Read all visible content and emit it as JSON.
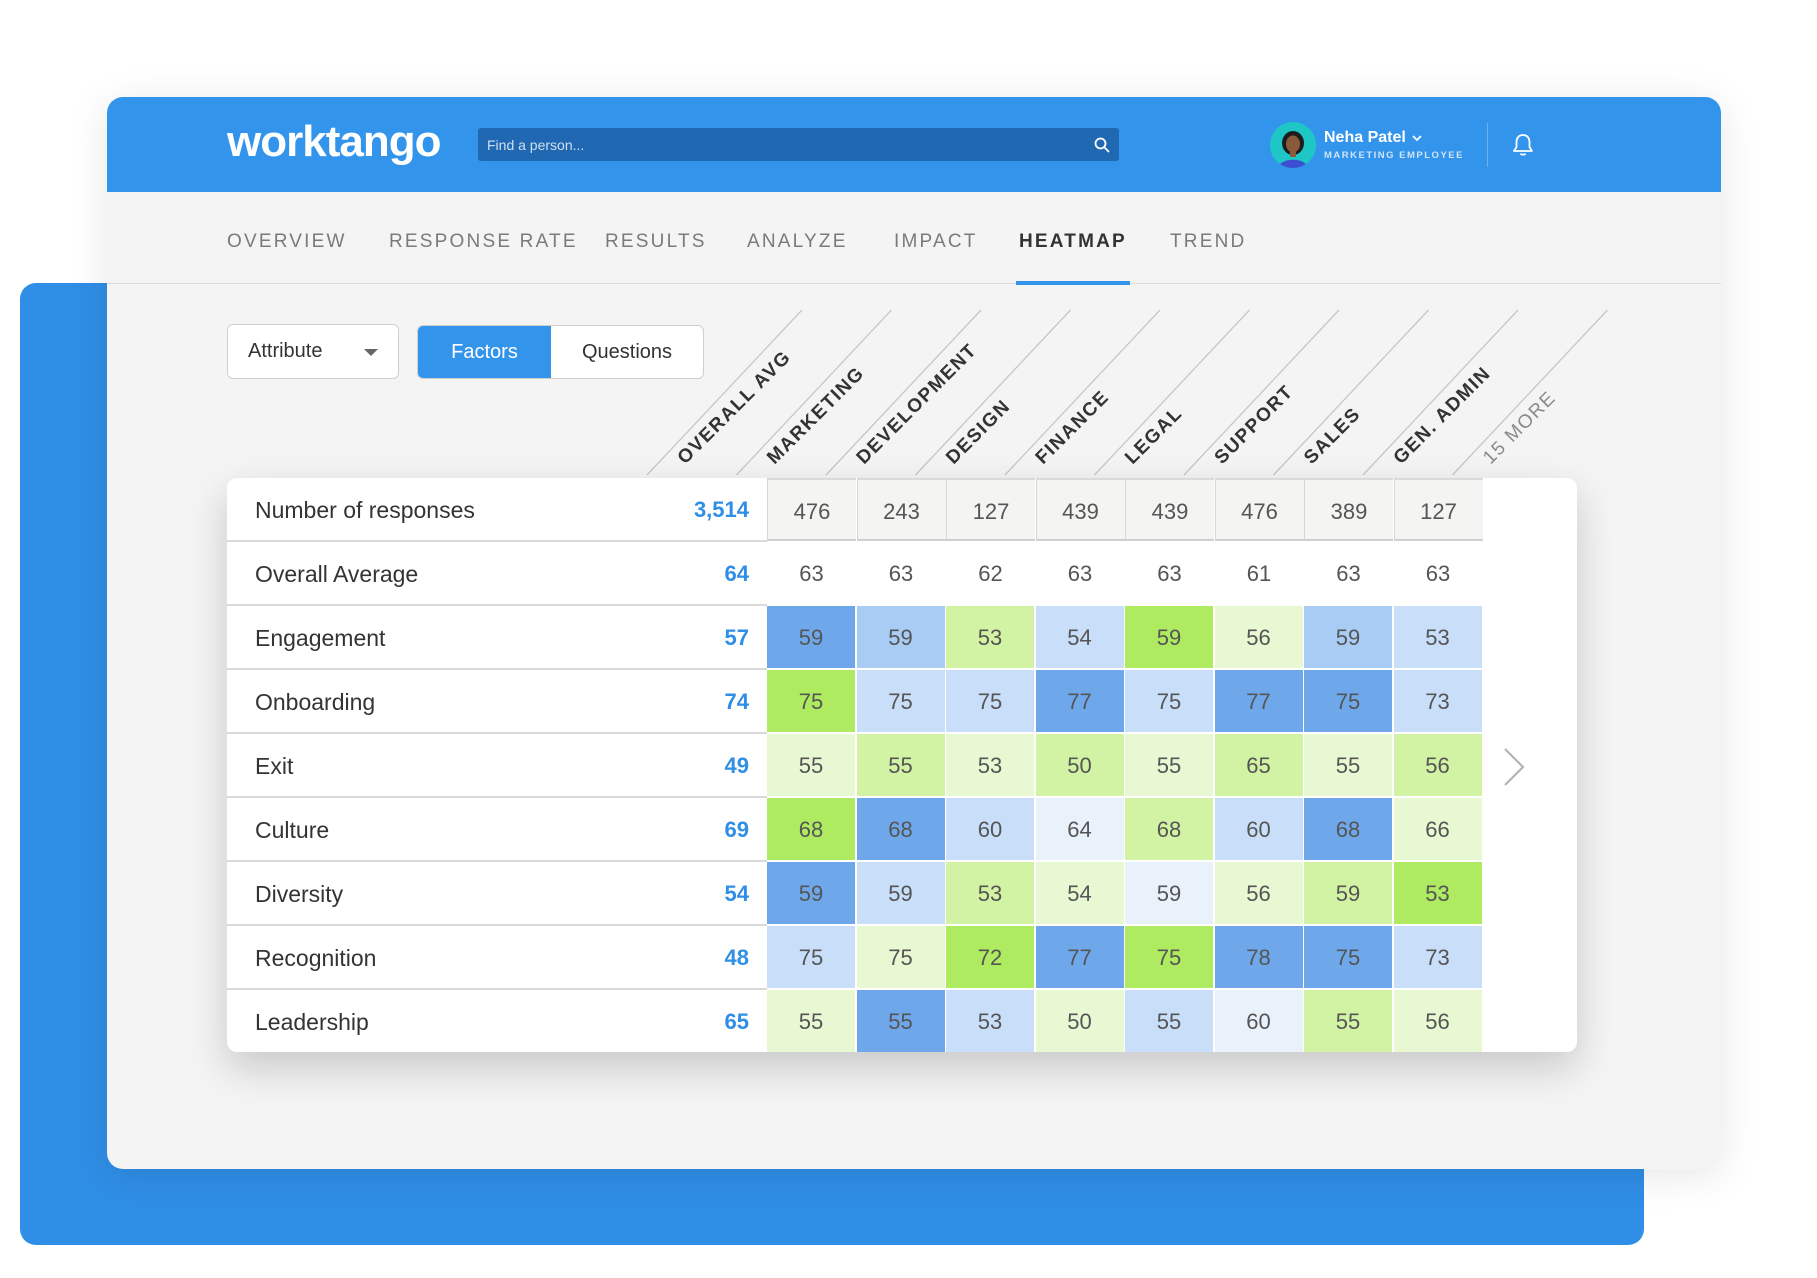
{
  "header": {
    "logo": "worktango",
    "search_placeholder": "Find a person...",
    "user_name": "Neha Patel",
    "user_role": "MARKETING EMPLOYEE"
  },
  "tabs": [
    {
      "label": "OVERVIEW",
      "active": false
    },
    {
      "label": "RESPONSE RATE",
      "active": false
    },
    {
      "label": "RESULTS",
      "active": false
    },
    {
      "label": "ANALYZE",
      "active": false
    },
    {
      "label": "IMPACT",
      "active": false
    },
    {
      "label": "HEATMAP",
      "active": true
    },
    {
      "label": "TREND",
      "active": false
    }
  ],
  "controls": {
    "dropdown_label": "Attribute",
    "toggle_on": "Factors",
    "toggle_off": "Questions"
  },
  "columns": [
    "OVERALL AVG",
    "MARKETING",
    "DEVELOPMENT",
    "DESIGN",
    "FINANCE",
    "LEGAL",
    "SUPPORT",
    "SALES",
    "GEN. ADMIN",
    "15 MORE"
  ],
  "colors": {
    "brand": "#3394ec",
    "accent_text": "#2f8ee6",
    "heat": {
      "b3": "#6ea8ea",
      "b2": "#a9ccf5",
      "b1": "#c8def9",
      "b0": "#e9f1fb",
      "g0": "#e8f8d2",
      "g1": "#d3f3a4",
      "g2": "#aeeb60"
    }
  },
  "rows": [
    {
      "label": "Number of responses",
      "avg": "3,514",
      "values": [
        "476",
        "243",
        "127",
        "439",
        "439",
        "476",
        "389",
        "127"
      ],
      "heat": []
    },
    {
      "label": "Overall Average",
      "avg": "64",
      "values": [
        "63",
        "63",
        "62",
        "63",
        "63",
        "61",
        "63",
        "63"
      ],
      "heat": []
    },
    {
      "label": "Engagement",
      "avg": "57",
      "values": [
        "59",
        "59",
        "53",
        "54",
        "59",
        "56",
        "59",
        "53"
      ],
      "heat": [
        "b3",
        "b2",
        "g1",
        "b1",
        "g2",
        "g0",
        "b2",
        "b1"
      ]
    },
    {
      "label": "Onboarding",
      "avg": "74",
      "values": [
        "75",
        "75",
        "75",
        "77",
        "75",
        "77",
        "75",
        "73"
      ],
      "heat": [
        "g2",
        "b1",
        "b1",
        "b3",
        "b1",
        "b3",
        "b3",
        "b1"
      ]
    },
    {
      "label": "Exit",
      "avg": "49",
      "values": [
        "55",
        "55",
        "53",
        "50",
        "55",
        "65",
        "55",
        "56"
      ],
      "heat": [
        "g0",
        "g1",
        "g0",
        "g1",
        "g0",
        "g1",
        "g0",
        "g1"
      ]
    },
    {
      "label": "Culture",
      "avg": "69",
      "values": [
        "68",
        "68",
        "60",
        "64",
        "68",
        "60",
        "68",
        "66"
      ],
      "heat": [
        "g2",
        "b3",
        "b1",
        "b0",
        "g1",
        "b1",
        "b3",
        "g0"
      ]
    },
    {
      "label": "Diversity",
      "avg": "54",
      "values": [
        "59",
        "59",
        "53",
        "54",
        "59",
        "56",
        "59",
        "53"
      ],
      "heat": [
        "b3",
        "b1",
        "g1",
        "g0",
        "b0",
        "g0",
        "g1",
        "g2"
      ]
    },
    {
      "label": "Recognition",
      "avg": "48",
      "values": [
        "75",
        "75",
        "72",
        "77",
        "75",
        "78",
        "75",
        "73"
      ],
      "heat": [
        "b1",
        "g0",
        "g2",
        "b3",
        "g2",
        "b3",
        "b3",
        "b1"
      ]
    },
    {
      "label": "Leadership",
      "avg": "65",
      "values": [
        "55",
        "55",
        "53",
        "50",
        "55",
        "60",
        "55",
        "56"
      ],
      "heat": [
        "g0",
        "b3",
        "b1",
        "g0",
        "b1",
        "b0",
        "g1",
        "g0"
      ]
    }
  ]
}
